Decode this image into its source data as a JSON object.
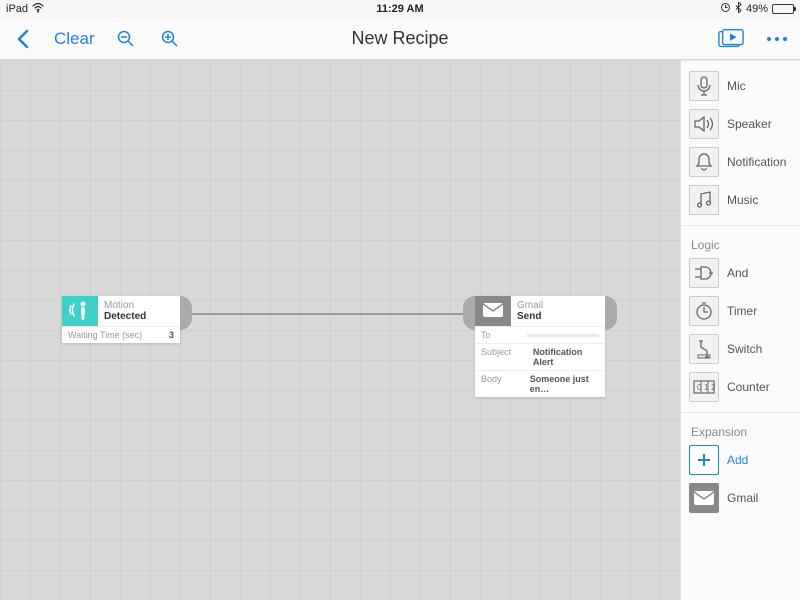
{
  "statusbar": {
    "device": "iPad",
    "time": "11:29 AM",
    "battery_pct": "49%"
  },
  "navbar": {
    "clear": "Clear",
    "title": "New Recipe"
  },
  "nodes": {
    "motion": {
      "type": "Motion",
      "state": "Detected",
      "param_label": "Waiting Time (sec)",
      "param_value": "3"
    },
    "gmail": {
      "type": "Gmail",
      "action": "Send",
      "to_label": "To",
      "to_value": "————————",
      "subject_label": "Subject",
      "subject_value": "Notification Alert",
      "body_label": "Body",
      "body_value": "Someone just en…"
    }
  },
  "sidebar": {
    "outputs": [
      {
        "label": "Mic",
        "icon": "mic"
      },
      {
        "label": "Speaker",
        "icon": "speaker"
      },
      {
        "label": "Notification",
        "icon": "bell"
      },
      {
        "label": "Music",
        "icon": "music"
      }
    ],
    "logic_heading": "Logic",
    "logic": [
      {
        "label": "And",
        "icon": "and"
      },
      {
        "label": "Timer",
        "icon": "timer"
      },
      {
        "label": "Switch",
        "icon": "switch"
      },
      {
        "label": "Counter",
        "icon": "counter"
      }
    ],
    "expansion_heading": "Expansion",
    "expansion": [
      {
        "label": "Add",
        "icon": "plus",
        "add": true
      },
      {
        "label": "Gmail",
        "icon": "mail",
        "dark": true
      }
    ]
  }
}
